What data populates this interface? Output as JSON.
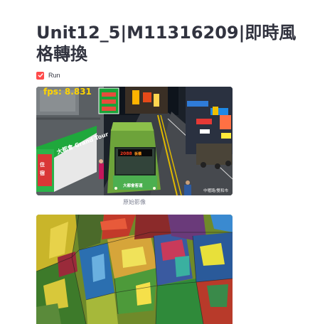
{
  "page": {
    "title": "Unit12_5|M11316209|即時風格轉換"
  },
  "controls": {
    "run_label": "Run",
    "run_checked": true
  },
  "video": {
    "fps_text": "fps: 8.831",
    "bus_route": "2088",
    "bus_dest": "Banqiao 板橋",
    "bus_plate_text": "大都會客運",
    "watermark": "中壢路/雙和市"
  },
  "captions": {
    "original": "原始影像"
  }
}
